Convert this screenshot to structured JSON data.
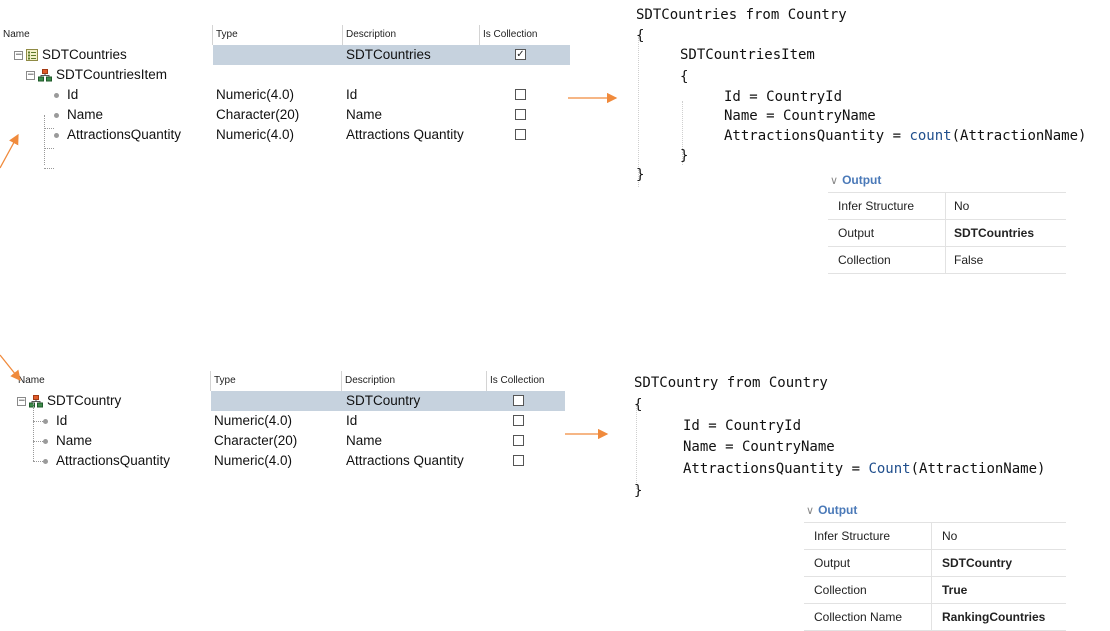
{
  "top_grid": {
    "headers": {
      "name": "Name",
      "type": "Type",
      "description": "Description",
      "is_collection": "Is Collection"
    },
    "rows": [
      {
        "name": "SDTCountries",
        "type": "",
        "description": "SDTCountries",
        "is_collection": true,
        "icon": "sdt-icon"
      },
      {
        "name": "SDTCountriesItem",
        "type": "",
        "description": "",
        "is_collection": null,
        "icon": "structure-item-icon"
      },
      {
        "name": "Id",
        "type": "Numeric(4.0)",
        "description": "Id",
        "is_collection": false,
        "icon": "attribute-dot-icon"
      },
      {
        "name": "Name",
        "type": "Character(20)",
        "description": "Name",
        "is_collection": false,
        "icon": "attribute-dot-icon"
      },
      {
        "name": "AttractionsQuantity",
        "type": "Numeric(4.0)",
        "description": "Attractions Quantity",
        "is_collection": false,
        "icon": "attribute-dot-icon"
      }
    ]
  },
  "bottom_grid": {
    "headers": {
      "name": "Name",
      "type": "Type",
      "description": "Description",
      "is_collection": "Is Collection"
    },
    "rows": [
      {
        "name": "SDTCountry",
        "type": "",
        "description": "SDTCountry",
        "is_collection": false,
        "icon": "structure-item-icon"
      },
      {
        "name": "Id",
        "type": "Numeric(4.0)",
        "description": "Id",
        "is_collection": false,
        "icon": "attribute-dot-icon"
      },
      {
        "name": "Name",
        "type": "Character(20)",
        "description": "Name",
        "is_collection": false,
        "icon": "attribute-dot-icon"
      },
      {
        "name": "AttractionsQuantity",
        "type": "Numeric(4.0)",
        "description": "Attractions Quantity",
        "is_collection": false,
        "icon": "attribute-dot-icon"
      }
    ]
  },
  "top_code": {
    "l1": "SDTCountries from Country",
    "l2": "{",
    "l3": "SDTCountriesItem",
    "l4": "{",
    "l5": "Id = CountryId",
    "l6": "Name = CountryName",
    "l7_pre": "AttractionsQuantity = ",
    "l7_fn": "count",
    "l7_post": "(AttractionName)",
    "l8": "}",
    "l9": "}"
  },
  "bottom_code": {
    "l1": "SDTCountry from Country",
    "l2": "{",
    "l3": "Id = CountryId",
    "l4": "Name = CountryName",
    "l5_pre": "AttractionsQuantity = ",
    "l5_fn": "Count",
    "l5_post": "(AttractionName)",
    "l6": "}"
  },
  "top_props": {
    "title": "Output",
    "rows": [
      {
        "key": "Infer Structure",
        "value": "No",
        "bold": false
      },
      {
        "key": "Output",
        "value": "SDTCountries",
        "bold": true
      },
      {
        "key": "Collection",
        "value": "False",
        "bold": false
      }
    ]
  },
  "bottom_props": {
    "title": "Output",
    "rows": [
      {
        "key": "Infer Structure",
        "value": "No",
        "bold": false
      },
      {
        "key": "Output",
        "value": "SDTCountry",
        "bold": true
      },
      {
        "key": "Collection",
        "value": "True",
        "bold": true
      },
      {
        "key": "Collection Name",
        "value": "RankingCountries",
        "bold": true
      }
    ]
  },
  "colors": {
    "arrow": "#f08a3c",
    "row_highlight": "#c6d2de",
    "keyword_fn": "#1f4e8c",
    "panel_title": "#4a79b8"
  }
}
